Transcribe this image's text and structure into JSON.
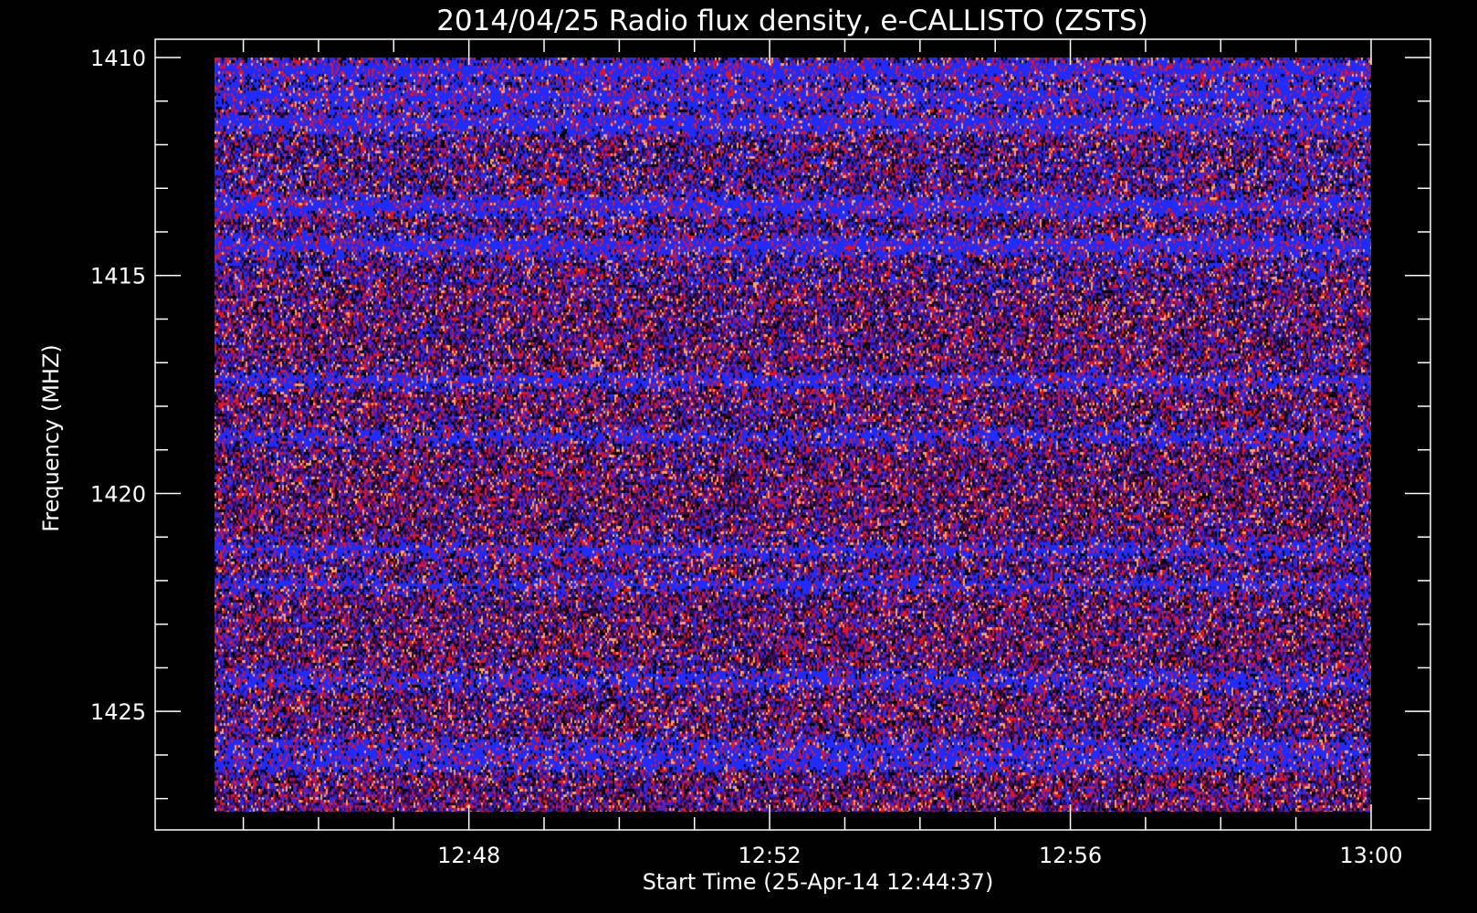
{
  "chart_data": {
    "type": "heatmap",
    "title": "2014/04/25  Radio flux density, e-CALLISTO (ZSTS)",
    "xlabel": "Start Time (25-Apr-14 12:44:37)",
    "ylabel": "Frequency (MHZ)",
    "x_ticks": [
      "12:48",
      "12:52",
      "12:56",
      "13:00"
    ],
    "y_ticks": [
      "1410",
      "1415",
      "1420",
      "1425"
    ],
    "xlim": [
      "12:44:37",
      "13:00:00"
    ],
    "ylim": [
      1410,
      1427.3
    ],
    "y_reversed": true,
    "grid": false,
    "legend": "none",
    "colors": {
      "background": "#000000",
      "frame": "#ffffff",
      "low": "#000000",
      "mid_low": "#3c0a5a",
      "mid": "#6a1c9e",
      "blue": "#1f2bff",
      "red": "#e6141e",
      "high": "#ffa060"
    },
    "blue_bands_mhz": [
      1410.3,
      1410.9,
      1411.5,
      1413.4,
      1414.3,
      1417.4,
      1418.7,
      1421.3,
      1422.1,
      1424.3,
      1425.8,
      1426.2
    ]
  }
}
